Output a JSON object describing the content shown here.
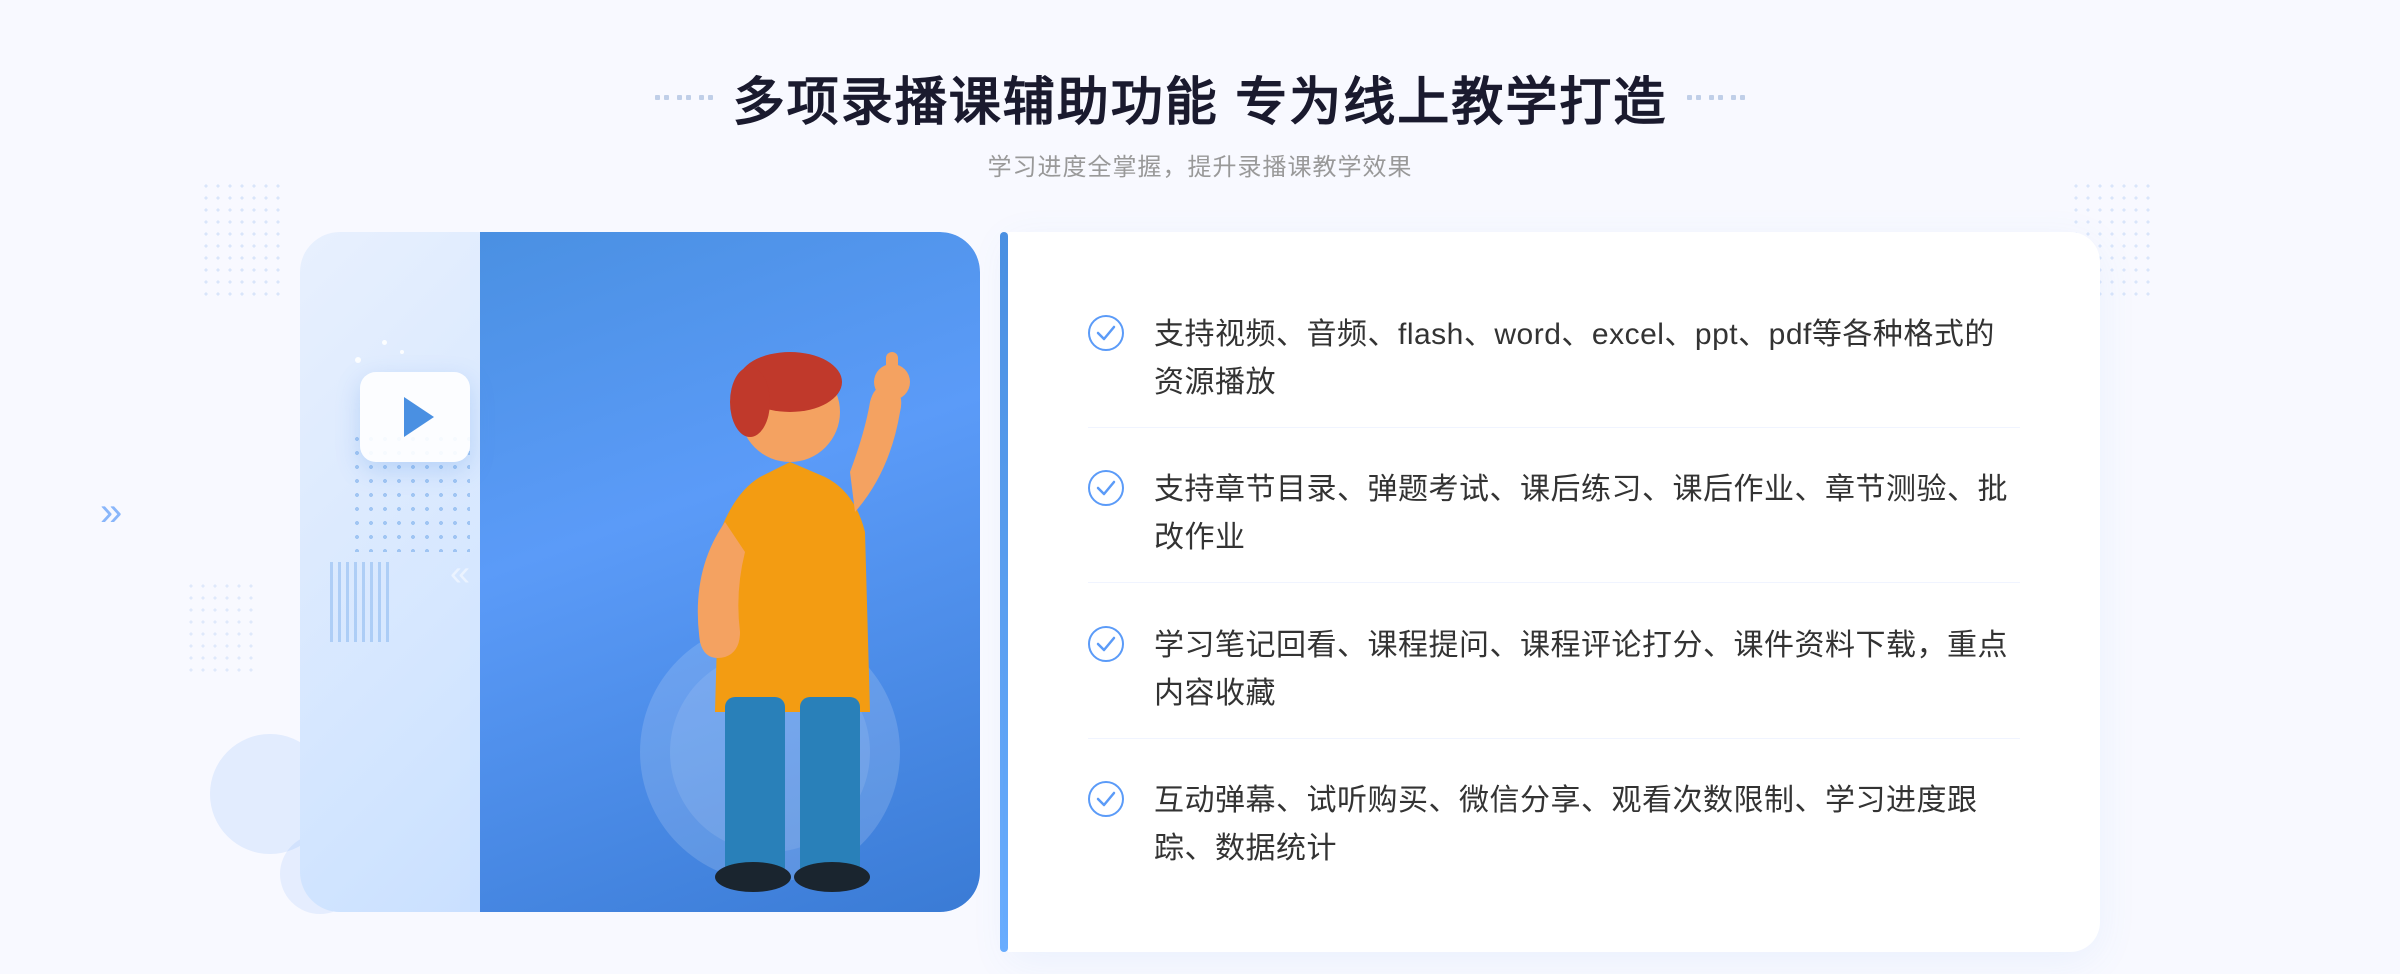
{
  "page": {
    "background_color": "#f8f9ff"
  },
  "header": {
    "title": "多项录播课辅助功能 专为线上教学打造",
    "subtitle": "学习进度全掌握，提升录播课教学效果",
    "title_decorator_left": "⠿",
    "title_decorator_right": "⠿"
  },
  "features": [
    {
      "id": 1,
      "text": "支持视频、音频、flash、word、excel、ppt、pdf等各种格式的资源播放"
    },
    {
      "id": 2,
      "text": "支持章节目录、弹题考试、课后练习、课后作业、章节测验、批改作业"
    },
    {
      "id": 3,
      "text": "学习笔记回看、课程提问、课程评论打分、课件资料下载，重点内容收藏"
    },
    {
      "id": 4,
      "text": "互动弹幕、试听购买、微信分享、观看次数限制、学习进度跟踪、数据统计"
    }
  ],
  "colors": {
    "primary_blue": "#4a90e2",
    "light_blue": "#6aaeff",
    "text_dark": "#333333",
    "text_gray": "#999999",
    "bg_light": "#f8f9ff",
    "check_color": "#5b9bf8"
  },
  "illustration": {
    "play_icon": "▶",
    "arrow_left": "»",
    "inner_arrow": "«"
  }
}
